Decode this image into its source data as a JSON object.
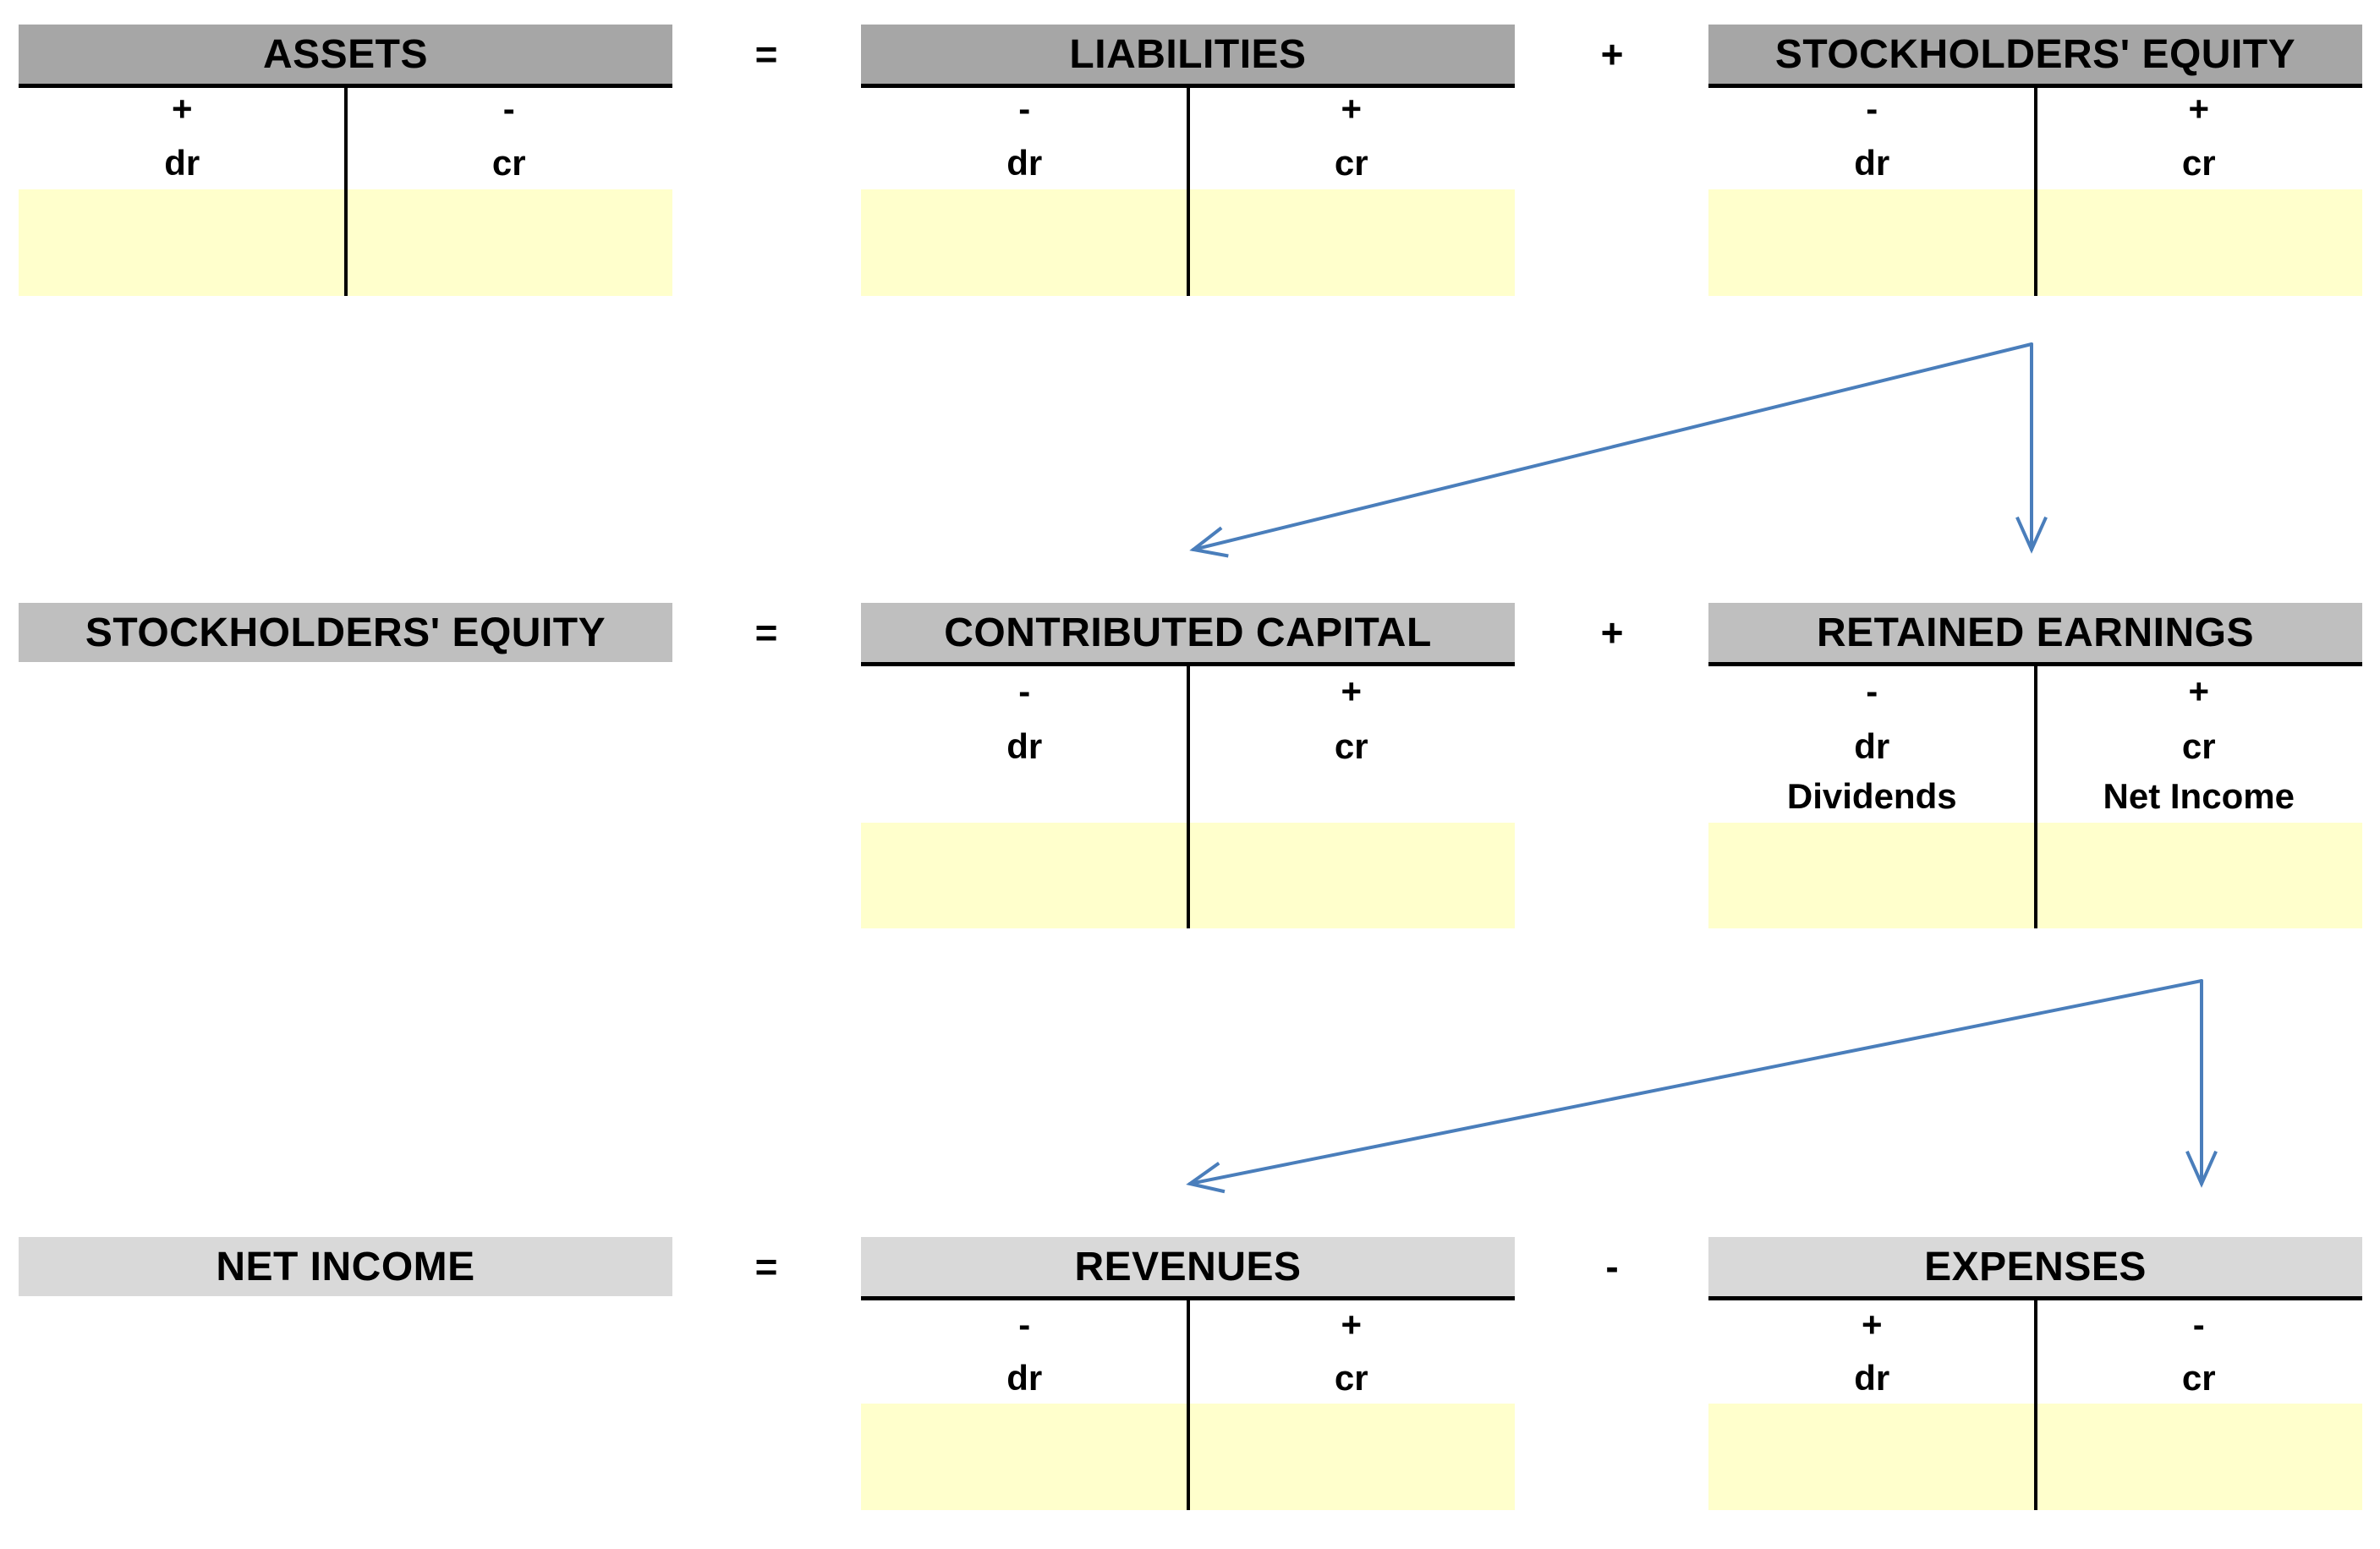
{
  "colors": {
    "row1_header": "#a6a6a6",
    "row2_header": "#bfbfbf",
    "row3_header": "#d9d9d9",
    "entry_area": "#ffffcc",
    "arrow": "#4a7ebb"
  },
  "rows": [
    {
      "operators": [
        "=",
        "+"
      ],
      "accounts": [
        {
          "title": "ASSETS",
          "t_account": true,
          "left_sign": "+",
          "right_sign": "-",
          "left_side": "dr",
          "right_side": "cr"
        },
        {
          "title": "LIABILITIES",
          "t_account": true,
          "left_sign": "-",
          "right_sign": "+",
          "left_side": "dr",
          "right_side": "cr"
        },
        {
          "title": "STOCKHOLDERS' EQUITY",
          "t_account": true,
          "left_sign": "-",
          "right_sign": "+",
          "left_side": "dr",
          "right_side": "cr"
        }
      ]
    },
    {
      "operators": [
        "=",
        "+"
      ],
      "accounts": [
        {
          "title": "STOCKHOLDERS' EQUITY",
          "t_account": false
        },
        {
          "title": "CONTRIBUTED CAPITAL",
          "t_account": true,
          "left_sign": "-",
          "right_sign": "+",
          "left_side": "dr",
          "right_side": "cr"
        },
        {
          "title": "RETAINED EARNINGS",
          "t_account": true,
          "left_sign": "-",
          "right_sign": "+",
          "left_side": "dr",
          "right_side": "cr",
          "left_item": "Dividends",
          "right_item": "Net Income"
        }
      ]
    },
    {
      "operators": [
        "=",
        "-"
      ],
      "accounts": [
        {
          "title": "NET INCOME",
          "t_account": false
        },
        {
          "title": "REVENUES",
          "t_account": true,
          "left_sign": "-",
          "right_sign": "+",
          "left_side": "dr",
          "right_side": "cr"
        },
        {
          "title": "EXPENSES",
          "t_account": true,
          "left_sign": "+",
          "right_sign": "-",
          "left_side": "dr",
          "right_side": "cr"
        }
      ]
    }
  ],
  "arrows": [
    {
      "from": "STOCKHOLDERS' EQUITY",
      "to": [
        "CONTRIBUTED CAPITAL",
        "RETAINED EARNINGS"
      ]
    },
    {
      "from": "RETAINED EARNINGS",
      "to": [
        "REVENUES",
        "EXPENSES"
      ]
    }
  ]
}
